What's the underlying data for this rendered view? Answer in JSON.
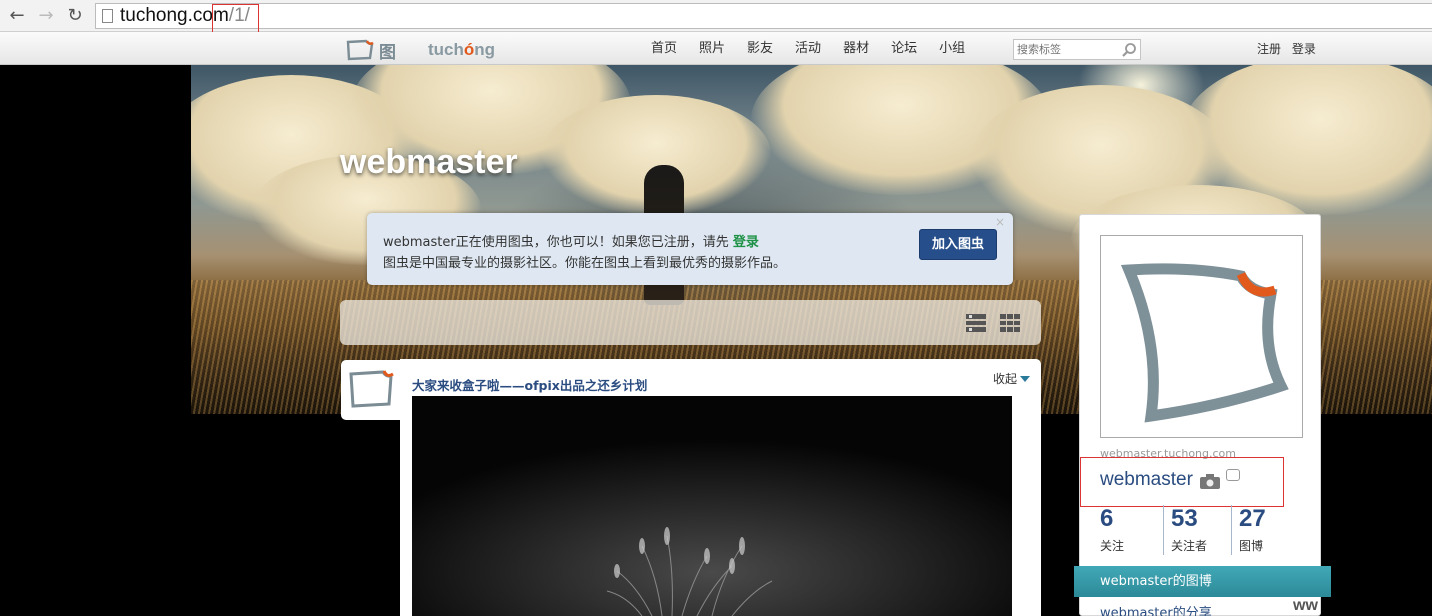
{
  "browser": {
    "url_host": "tuchong.com",
    "url_path": "/1/"
  },
  "site": {
    "logo_cn": "图虫",
    "logo_en_pre": "tuch",
    "logo_en_o": "ó",
    "logo_en_post": "ng",
    "accent_color": "#e2591c",
    "nav": [
      "首页",
      "照片",
      "影友",
      "活动",
      "器材",
      "论坛",
      "小组"
    ],
    "search_placeholder": "搜索标签",
    "register": "注册",
    "login": "登录"
  },
  "hero": {
    "title": "webmaster"
  },
  "notice": {
    "line1_prefix": "webmaster正在使用图虫，你也可以！如果您已注册，请先 ",
    "line1_login": "登录",
    "line2": "图虫是中国最专业的摄影社区。你能在图虫上看到最优秀的摄影作品。",
    "close": "×",
    "join_button": "加入图虫"
  },
  "post": {
    "title": "大家来收盒子啦——ofpix出品之还乡计划",
    "collapse_label": "收起"
  },
  "profile": {
    "domain": "webmaster.tuchong.com",
    "name": "webmaster",
    "stats": [
      {
        "value": "6",
        "label": "关注"
      },
      {
        "value": "53",
        "label": "关注者"
      },
      {
        "value": "27",
        "label": "图博"
      }
    ],
    "blog_tab": "webmaster的图博",
    "share_link": "webmaster的分享",
    "tab_color": "#41a8b7"
  },
  "corner_text": "ww"
}
